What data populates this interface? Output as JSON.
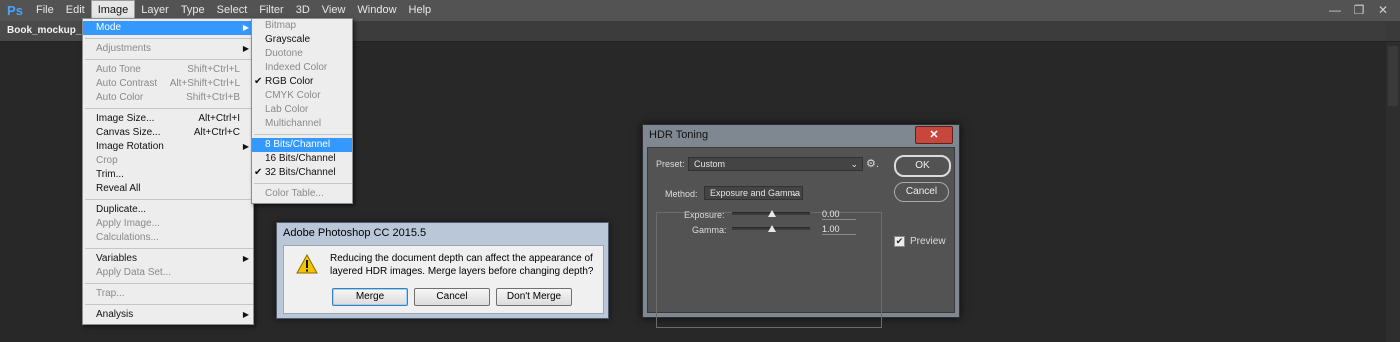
{
  "app": {
    "logo": "Ps"
  },
  "menubar": [
    "File",
    "Edit",
    "Image",
    "Layer",
    "Type",
    "Select",
    "Filter",
    "3D",
    "View",
    "Window",
    "Help"
  ],
  "window_controls": {
    "minimize": "—",
    "restore": "❐",
    "close": "✕"
  },
  "doc_tab": "Book_mockup_mar",
  "image_menu": [
    {
      "label": "Mode",
      "sel": true,
      "arrow": true
    },
    {
      "sep": true
    },
    {
      "label": "Adjustments",
      "disabled": true,
      "arrow": true
    },
    {
      "sep": true
    },
    {
      "label": "Auto Tone",
      "disabled": true,
      "sc": "Shift+Ctrl+L"
    },
    {
      "label": "Auto Contrast",
      "disabled": true,
      "sc": "Alt+Shift+Ctrl+L"
    },
    {
      "label": "Auto Color",
      "disabled": true,
      "sc": "Shift+Ctrl+B"
    },
    {
      "sep": true
    },
    {
      "label": "Image Size...",
      "sc": "Alt+Ctrl+I"
    },
    {
      "label": "Canvas Size...",
      "sc": "Alt+Ctrl+C"
    },
    {
      "label": "Image Rotation",
      "arrow": true
    },
    {
      "label": "Crop",
      "disabled": true
    },
    {
      "label": "Trim..."
    },
    {
      "label": "Reveal All"
    },
    {
      "sep": true
    },
    {
      "label": "Duplicate..."
    },
    {
      "label": "Apply Image...",
      "disabled": true
    },
    {
      "label": "Calculations...",
      "disabled": true
    },
    {
      "sep": true
    },
    {
      "label": "Variables",
      "arrow": true
    },
    {
      "label": "Apply Data Set...",
      "disabled": true
    },
    {
      "sep": true
    },
    {
      "label": "Trap...",
      "disabled": true
    },
    {
      "sep": true
    },
    {
      "label": "Analysis",
      "arrow": true
    }
  ],
  "mode_menu": [
    {
      "label": "Bitmap",
      "disabled": true
    },
    {
      "label": "Grayscale"
    },
    {
      "label": "Duotone",
      "disabled": true
    },
    {
      "label": "Indexed Color",
      "disabled": true
    },
    {
      "label": "RGB Color",
      "check": true
    },
    {
      "label": "CMYK Color",
      "disabled": true
    },
    {
      "label": "Lab Color",
      "disabled": true
    },
    {
      "label": "Multichannel",
      "disabled": true
    },
    {
      "sep": true
    },
    {
      "label": "8 Bits/Channel",
      "sel": true
    },
    {
      "label": "16 Bits/Channel"
    },
    {
      "label": "32 Bits/Channel",
      "check": true
    },
    {
      "sep": true
    },
    {
      "label": "Color Table...",
      "disabled": true
    }
  ],
  "alert": {
    "title": "Adobe Photoshop CC 2015.5",
    "message": "Reducing the document depth can affect the appearance of layered HDR images.  Merge layers before changing depth?",
    "buttons": {
      "merge": "Merge",
      "cancel": "Cancel",
      "dont_merge": "Don't Merge"
    }
  },
  "hdr": {
    "title": "HDR Toning",
    "close": "✕",
    "preset_label": "Preset:",
    "preset_value": "Custom",
    "method_label": "Method:",
    "method_value": "Exposure and Gamma",
    "exposure_label": "Exposure:",
    "exposure_value": "0.00",
    "gamma_label": "Gamma:",
    "gamma_value": "1.00",
    "ok": "OK",
    "cancel": "Cancel",
    "preview": "Preview",
    "preview_checked": true
  }
}
